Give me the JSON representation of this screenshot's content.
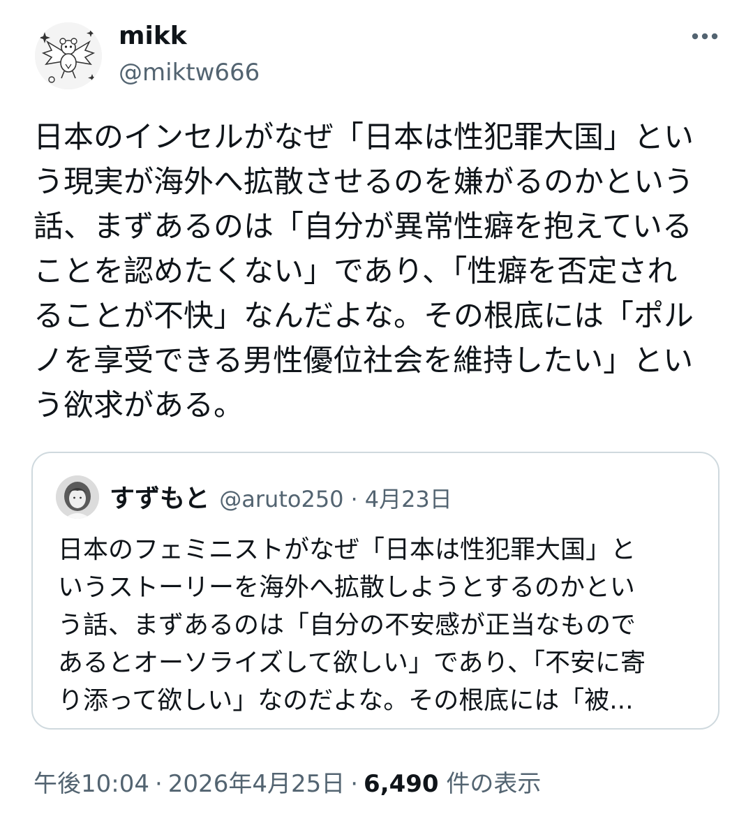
{
  "author": {
    "display_name": "mikk",
    "handle": "@miktw666",
    "avatar_icon": "bat-bear-illustration-icon"
  },
  "more_icon": "more-horizontal-icon",
  "tweet": {
    "text_lines": [
      "日本のインセルがなぜ「日本は性犯罪大国」とい",
      "う現実が海外へ拡散させるのを嫌がるのかという",
      "話、まずあるのは「自分が異常性癖を抱えている",
      "ことを認めたくない」であり、「性癖を否定され",
      "ることが不快」なんだよな。その根底には「ポル",
      "ノを享受できる男性優位社会を維持したい」とい",
      "う欲求がある。"
    ]
  },
  "quoted": {
    "display_name": "すずもと",
    "handle": "@aruto250",
    "separator": "·",
    "date": "4月23日",
    "avatar_icon": "portrait-photo-icon",
    "text_lines": [
      "日本のフェミニストがなぜ「日本は性犯罪大国」と",
      "いうストーリーを海外へ拡散しようとするのかとい",
      "う話、まずあるのは「自分の不安感が正当なもので",
      "あるとオーソライズして欲しい」であり、「不安に寄",
      "り添って欲しい」なのだよな。その根底には「被..."
    ]
  },
  "meta": {
    "time": "午後10:04",
    "separator": "·",
    "date": "2026年4月25日",
    "views_count": "6,490",
    "views_label": " 件の表示"
  },
  "colors": {
    "text": "#0f1419",
    "secondary": "#536471",
    "border": "#cfd9de"
  }
}
